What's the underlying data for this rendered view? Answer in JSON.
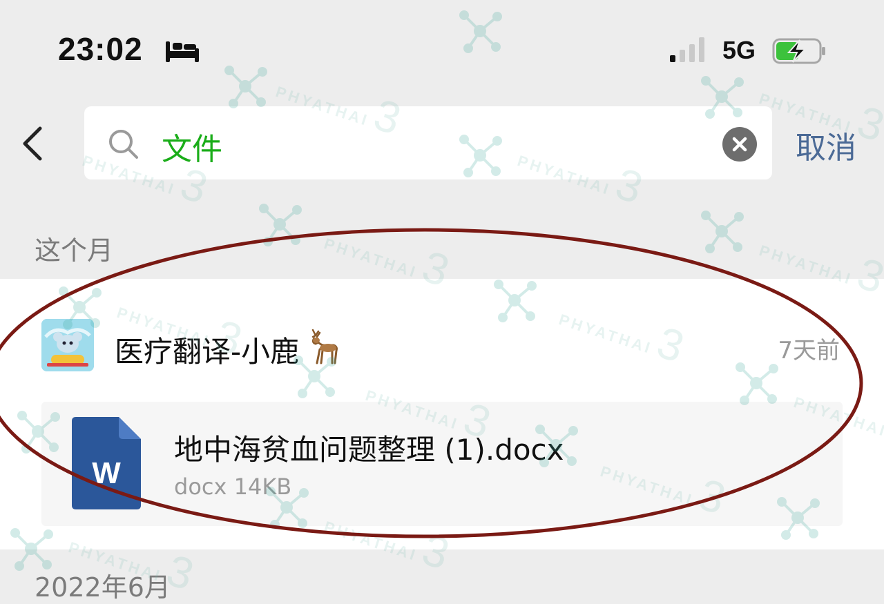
{
  "status_bar": {
    "time": "23:02",
    "network": "5G",
    "icons": [
      "bed-icon",
      "signal-icon",
      "battery-charging-icon"
    ]
  },
  "search": {
    "value": "文件",
    "cancel_label": "取消",
    "accent_color": "#1aad19"
  },
  "sections": [
    {
      "header": "这个月",
      "results": [
        {
          "chat_name": "医疗翻译-小鹿",
          "chat_emoji": "deer-icon",
          "time": "7天前",
          "file": {
            "name": "地中海贫血问题整理 (1).docx",
            "meta": "docx 14KB",
            "icon": "word-document-icon"
          }
        }
      ]
    },
    {
      "header": "2022年6月"
    }
  ],
  "watermark": {
    "text": "PHYATHAI",
    "number": "3"
  },
  "colors": {
    "background": "#ededed",
    "link": "#4b6a96",
    "annotation": "#7a1a14",
    "word_blue": "#2b579a"
  }
}
